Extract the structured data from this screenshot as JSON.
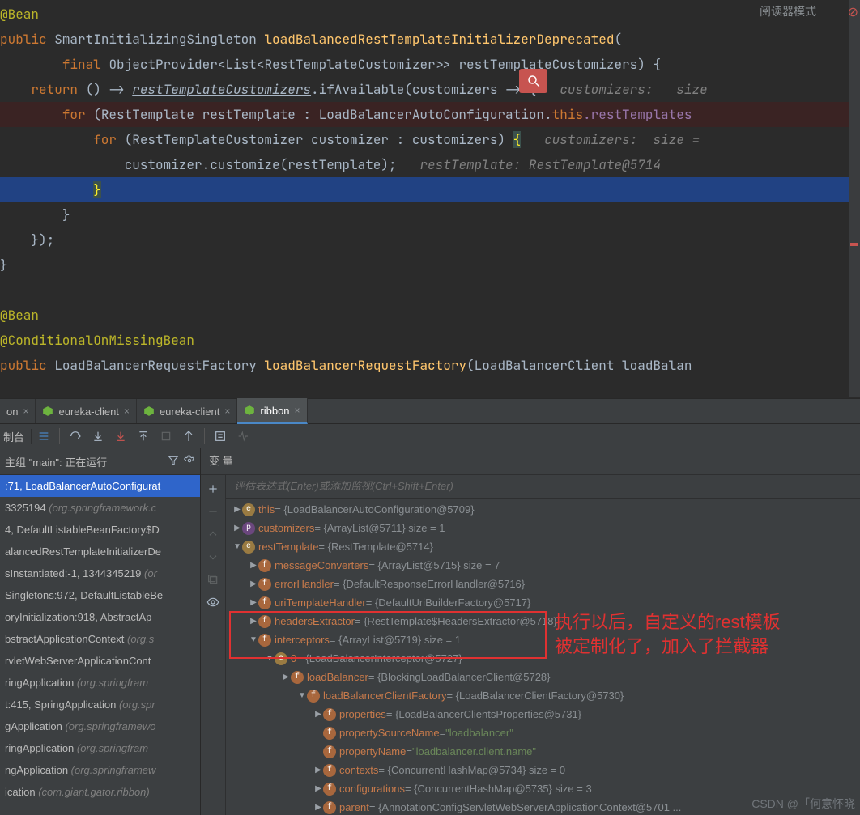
{
  "reader_mode": "阅读器模式",
  "code": {
    "ann_bean": "@Bean",
    "kw_public": "public",
    "type_sis": "SmartInitializingSingleton",
    "m_load": "loadBalancedRestTemplateInitializerDeprecated",
    "kw_final": "final",
    "type_op": "ObjectProvider<List<RestTemplateCustomizer>>",
    "p_rtc": "restTemplateCustomizers) {",
    "kw_return": "return",
    "lambda": "() -> ",
    "rtc_call": "restTemplateCustomizers",
    "if_avail": ".ifAvailable(customizers -> {",
    "hint1": "customizers:   size",
    "kw_for": "for",
    "for1": "(RestTemplate restTemplate : LoadBalancerAutoConfiguration.",
    "this": "this",
    "rest_templates": ".restTemplates",
    "for2": "(RestTemplateCustomizer customizer : customizers) ",
    "hint2": "customizers:  size =",
    "cust_call": "customizer.customize(restTemplate);",
    "hint3": "restTemplate: RestTemplate@5714",
    "brace_close": "}",
    "end_lambda": "});",
    "ann_cond": "@ConditionalOnMissingBean",
    "type_lbrf": "LoadBalancerRequestFactory",
    "m_lbrf": "loadBalancerRequestFactory",
    "sig_lbrf": "(LoadBalancerClient loadBalan"
  },
  "tabs": {
    "t0": "on",
    "t1": "eureka-client",
    "t2": "eureka-client",
    "t3": "ribbon"
  },
  "toolbar": {
    "console": "制台"
  },
  "frames": {
    "head": "\"main\": 正在运行",
    "group_prefix": "主组",
    "rows": [
      {
        "txt": ":71, LoadBalancerAutoConfigurat",
        "pkg": ""
      },
      {
        "txt": "3325194 ",
        "pkg": "(org.springframework.c"
      },
      {
        "txt": "4, DefaultListableBeanFactory$D",
        "pkg": ""
      },
      {
        "txt": "alancedRestTemplateInitializerDe",
        "pkg": ""
      },
      {
        "txt": "sInstantiated:-1, 1344345219 ",
        "pkg": "(or"
      },
      {
        "txt": "Singletons:972, DefaultListableBe",
        "pkg": ""
      },
      {
        "txt": "oryInitialization:918, AbstractAp",
        "pkg": ""
      },
      {
        "txt": "bstractApplicationContext ",
        "pkg": "(org.s"
      },
      {
        "txt": "rvletWebServerApplicationCont",
        "pkg": ""
      },
      {
        "txt": "ringApplication ",
        "pkg": "(org.springfram"
      },
      {
        "txt": "t:415, SpringApplication ",
        "pkg": "(org.spr"
      },
      {
        "txt": "gApplication ",
        "pkg": "(org.springframewo"
      },
      {
        "txt": "ringApplication ",
        "pkg": "(org.springfram"
      },
      {
        "txt": "ngApplication ",
        "pkg": "(org.springframew"
      },
      {
        "txt": "ication ",
        "pkg": "(com.giant.gator.ribbon)"
      }
    ]
  },
  "vars": {
    "title": "变 量",
    "eval_hint": "评估表达式(Enter)或添加监视(Ctrl+Shift+Enter)",
    "tree": [
      {
        "d": 0,
        "a": "▶",
        "ic": "e",
        "name": "this",
        "val": " = {LoadBalancerAutoConfiguration@5709}"
      },
      {
        "d": 0,
        "a": "▶",
        "ic": "p",
        "name": "customizers",
        "val": " = {ArrayList@5711}  size = 1"
      },
      {
        "d": 0,
        "a": "▼",
        "ic": "e",
        "name": "restTemplate",
        "val": " = {RestTemplate@5714}"
      },
      {
        "d": 1,
        "a": "▶",
        "ic": "f",
        "name": "messageConverters",
        "val": " = {ArrayList@5715}  size = 7"
      },
      {
        "d": 1,
        "a": "▶",
        "ic": "f",
        "name": "errorHandler",
        "val": " = {DefaultResponseErrorHandler@5716}"
      },
      {
        "d": 1,
        "a": "▶",
        "ic": "f",
        "name": "uriTemplateHandler",
        "val": " = {DefaultUriBuilderFactory@5717}"
      },
      {
        "d": 1,
        "a": "▶",
        "ic": "f",
        "name": "headersExtractor",
        "val": " = {RestTemplate$HeadersExtractor@5718}"
      },
      {
        "d": 1,
        "a": "▼",
        "ic": "f",
        "name": "interceptors",
        "val": " = {ArrayList@5719}  size = 1"
      },
      {
        "d": 2,
        "a": "▼",
        "ic": "e",
        "name": "0",
        "val": " = {LoadBalancerInterceptor@5727}"
      },
      {
        "d": 3,
        "a": "▶",
        "ic": "f",
        "name": "loadBalancer",
        "val": " = {BlockingLoadBalancerClient@5728}"
      },
      {
        "d": 4,
        "a": "▼",
        "ic": "f",
        "name": "loadBalancerClientFactory",
        "val": " = {LoadBalancerClientFactory@5730}"
      },
      {
        "d": 5,
        "a": "▶",
        "ic": "f",
        "name": "properties",
        "val": " = {LoadBalancerClientsProperties@5731}"
      },
      {
        "d": 5,
        "a": "",
        "ic": "f",
        "name": "propertySourceName",
        "val": " = ",
        "str": "\"loadbalancer\""
      },
      {
        "d": 5,
        "a": "",
        "ic": "f",
        "name": "propertyName",
        "val": " = ",
        "str": "\"loadbalancer.client.name\""
      },
      {
        "d": 5,
        "a": "▶",
        "ic": "f",
        "name": "contexts",
        "val": " = {ConcurrentHashMap@5734}  size = 0"
      },
      {
        "d": 5,
        "a": "▶",
        "ic": "f",
        "name": "configurations",
        "val": " = {ConcurrentHashMap@5735}  size = 3"
      },
      {
        "d": 5,
        "a": "▶",
        "ic": "f",
        "name": "parent",
        "val": " = {AnnotationConfigServletWebServerApplicationContext@5701 ..."
      }
    ]
  },
  "annot": {
    "l1": "执行以后，自定义的rest模板",
    "l2": "被定制化了，加入了拦截器"
  },
  "watermark": "CSDN @「何意怀晓"
}
